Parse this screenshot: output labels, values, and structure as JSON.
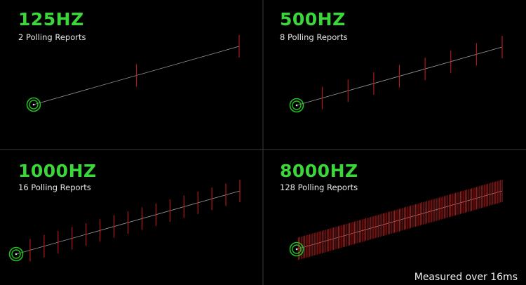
{
  "panels": [
    {
      "title": "125HZ",
      "subtitle": "2 Polling Reports",
      "reports": 2
    },
    {
      "title": "500HZ",
      "subtitle": "8 Polling Reports",
      "reports": 8
    },
    {
      "title": "1000HZ",
      "subtitle": "16 Polling Reports",
      "reports": 16
    },
    {
      "title": "8000HZ",
      "subtitle": "128 Polling Reports",
      "reports": 128
    }
  ],
  "footer": {
    "note": "Measured over 16ms"
  },
  "colors": {
    "background": "#000000",
    "grid": "#3a3a3a",
    "title": "#3ad63a",
    "trace": "#9a9a9a",
    "report_tick": "#c01a1a",
    "cursor_ring": "#22c022"
  },
  "icons": {
    "start_marker": "cursor-origin-icon"
  }
}
